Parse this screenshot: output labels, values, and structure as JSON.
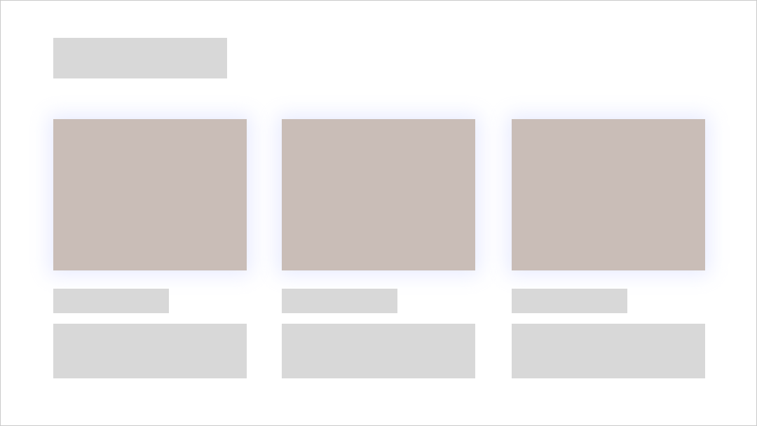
{
  "page": {
    "title": ""
  },
  "cards": [
    {
      "label": "",
      "body": ""
    },
    {
      "label": "",
      "body": ""
    },
    {
      "label": "",
      "body": ""
    }
  ],
  "colors": {
    "background": "#ffffff",
    "border": "#c9c9c9",
    "placeholder": "#d8d8d8",
    "image_placeholder": "#c9bdb7",
    "image_glow": "#cdd2ff"
  }
}
